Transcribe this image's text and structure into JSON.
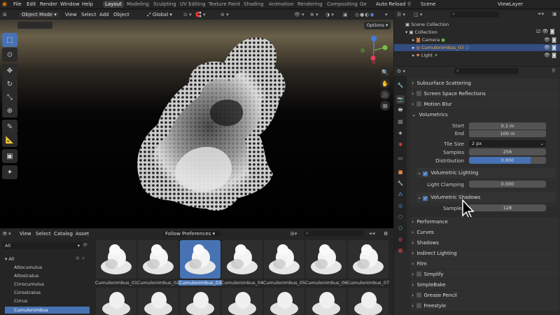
{
  "menu": [
    "File",
    "Edit",
    "Render",
    "Window",
    "Help"
  ],
  "workspaces": [
    "Layout",
    "Modeling",
    "Sculpting",
    "UV Editing",
    "Texture Paint",
    "Shading",
    "Animation",
    "Rendering",
    "Compositing",
    "Ge"
  ],
  "top_right": {
    "auto_reload": "Auto Reload",
    "scene": "Scene",
    "view_layer": "ViewLayer"
  },
  "viewport_header": {
    "mode": "Object Mode",
    "view": "View",
    "select": "Select",
    "add": "Add",
    "object": "Object",
    "orientation": "Global",
    "options": "Options"
  },
  "asset_browser": {
    "menu": [
      "View",
      "Select",
      "Catalog",
      "Asset"
    ],
    "filter": "Follow Preferences",
    "library": "All",
    "catalog_root": "All",
    "catalogs": [
      "Altocumulus",
      "Altostratus",
      "Cirrocumulus",
      "Cirrostratus",
      "Cirrus",
      "Cumulonimbus"
    ],
    "selected_catalog": "Cumulonimbus",
    "assets": [
      "Cumulonimbus_01",
      "Cumulonimbus_02",
      "Cumulonimbus_03",
      "Cumulonimbus_04",
      "Cumulonimbus_05",
      "Cumulonimbus_06",
      "Cumulonimbus_07"
    ],
    "selected_asset": "Cumulonimbus_03"
  },
  "outliner": {
    "root": "Scene Collection",
    "collection": "Collection",
    "items": [
      "Camera",
      "Cumulonimbus_03",
      "Light"
    ],
    "selected": "Cumulonimbus_03"
  },
  "properties": {
    "collapsed_top": [
      "Subsurface Scattering",
      "Screen Space Reflections",
      "Motion Blur"
    ],
    "volumetrics": {
      "title": "Volumetrics",
      "start_label": "Start",
      "start": "0.1 m",
      "end_label": "End",
      "end": "100 m",
      "tile_label": "Tile Size",
      "tile": "2 px",
      "samples_label": "Samples",
      "samples": "256",
      "distribution_label": "Distribution",
      "distribution": "0.800",
      "distribution_fraction": 0.8,
      "vol_lighting": "Volumetric Lighting",
      "light_clamp_label": "Light Clamping",
      "light_clamp": "0.000",
      "vol_shadows": "Volumetric Shadows",
      "shadow_samples_label": "Samples",
      "shadow_samples": "128"
    },
    "collapsed_bottom": [
      "Performance",
      "Curves",
      "Shadows",
      "Indirect Lighting",
      "Film",
      "Simplify",
      "SimpleBake",
      "Grease Pencil",
      "Freestyle"
    ]
  },
  "colors": {
    "accent": "#4772b3",
    "panel": "#303030",
    "field": "#545454"
  }
}
